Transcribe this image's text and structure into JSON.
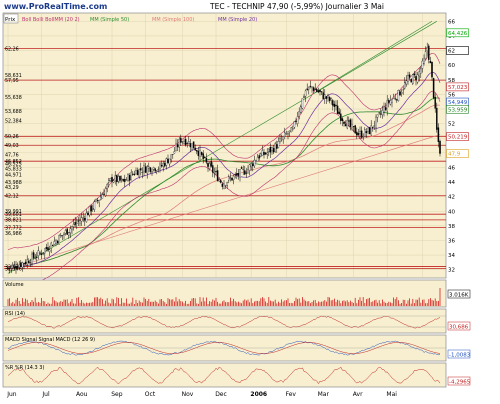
{
  "header": {
    "site": "www.ProRealTime.com",
    "title": "TEC - TECHNIP  47,90 (-5,99%)  Journalier  3 Mai"
  },
  "main_panel": {
    "label": "Prix",
    "indicator_labels": [
      {
        "text": "Boll Bolli BollMM (20 2)",
        "color": "#c03070"
      },
      {
        "text": "MM (Simple 50)",
        "color": "#2e8b2e"
      },
      {
        "text": "MM (Simple 100)",
        "color": "#e07a7a"
      },
      {
        "text": "MM (Simple 20)",
        "color": "#7030a0"
      }
    ]
  },
  "sub_panels": {
    "volume": {
      "label": "Volume",
      "value_tag": "3.016K"
    },
    "rsi": {
      "label": "RSI (14)",
      "value_tag": "30,686"
    },
    "macd": {
      "label": "MACD Signal Signal MACD (12 26 9)",
      "value_tag": "-1,0083"
    },
    "williams": {
      "label": "%R %R (14.3 3)",
      "value_tag": "-4,2965"
    }
  },
  "price_tags": [
    {
      "value": "64,426",
      "color": "#00aa00"
    },
    {
      "value": "62",
      "color": "#000000"
    },
    {
      "value": "57,023",
      "color": "#c02020"
    },
    {
      "value": "54,949",
      "color": "#2050c0"
    },
    {
      "value": "53,959",
      "color": "#208020"
    },
    {
      "value": "50,219",
      "color": "#c02020"
    },
    {
      "value": "47,9",
      "color": "#e0a020"
    }
  ],
  "chart_data": {
    "type": "candlestick",
    "ylim": [
      31,
      67
    ],
    "x_labels": [
      "Jun",
      "Jul",
      "Aou",
      "Sep",
      "Oct",
      "Nov",
      "Dec",
      "2006",
      "Fev",
      "Mar",
      "Avr",
      "Mai"
    ],
    "y_ticks": [
      32,
      34,
      36,
      38,
      40,
      42,
      44,
      46,
      48,
      50,
      52,
      54,
      56,
      58,
      60,
      62,
      64,
      66
    ],
    "left_levels": [
      "62,26",
      "58,631",
      "57,95",
      "55,638",
      "53,688",
      "52,384",
      "50,26",
      "49,03",
      "47,76",
      "46,852",
      "46,525",
      "45,833",
      "44,971",
      "43,988",
      "43,29",
      "42,12",
      "39,991",
      "39,601",
      "38,821",
      "37,772",
      "36,986",
      "32,43",
      "32,146"
    ],
    "close_path": [
      [
        0,
        32.2
      ],
      [
        10,
        33.0
      ],
      [
        20,
        34.2
      ],
      [
        30,
        36.0
      ],
      [
        38,
        37.5
      ],
      [
        48,
        39.3
      ],
      [
        58,
        42.0
      ],
      [
        65,
        44.5
      ],
      [
        72,
        44.0
      ],
      [
        80,
        45.5
      ],
      [
        88,
        46.0
      ],
      [
        95,
        46.0
      ],
      [
        102,
        47.5
      ],
      [
        108,
        49.8
      ],
      [
        112,
        49.6
      ],
      [
        118,
        48.5
      ],
      [
        124,
        46.5
      ],
      [
        130,
        45.0
      ],
      [
        134,
        43.8
      ],
      [
        138,
        44.3
      ],
      [
        144,
        45.0
      ],
      [
        150,
        45.8
      ],
      [
        156,
        47.5
      ],
      [
        162,
        48.0
      ],
      [
        168,
        49.0
      ],
      [
        174,
        50.5
      ],
      [
        178,
        51.0
      ],
      [
        182,
        54.0
      ],
      [
        186,
        56.5
      ],
      [
        190,
        57.0
      ],
      [
        196,
        56.0
      ],
      [
        202,
        55.0
      ],
      [
        208,
        53.0
      ],
      [
        214,
        51.5
      ],
      [
        220,
        50.5
      ],
      [
        226,
        51.0
      ],
      [
        232,
        53.0
      ],
      [
        238,
        55.0
      ],
      [
        244,
        56.0
      ],
      [
        250,
        58.0
      ],
      [
        256,
        58.5
      ],
      [
        260,
        60.5
      ],
      [
        262,
        62.5
      ],
      [
        264,
        60.0
      ],
      [
        266,
        56.0
      ],
      [
        268,
        51.0
      ],
      [
        270,
        47.9
      ]
    ],
    "series": [
      {
        "name": "Boll Bolli BollMM (20 2)",
        "color": "#c03070"
      },
      {
        "name": "MM (Simple 50)",
        "color": "#2e8b2e"
      },
      {
        "name": "MM (Simple 100)",
        "color": "#e07a7a"
      },
      {
        "name": "MM (Simple 20)",
        "color": "#7030a0"
      }
    ],
    "red_levels": [
      62.26,
      57.95,
      50.26,
      49.03,
      46.852,
      42.12,
      39.601,
      38.821,
      37.772,
      32.43,
      32.146
    ],
    "last_close": 47.9,
    "last_change_pct": -5.99
  }
}
